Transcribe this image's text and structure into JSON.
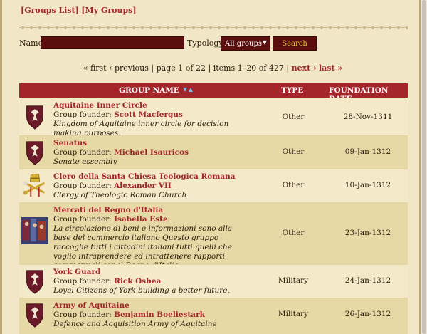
{
  "top_links": {
    "groups_list": "[Groups List]",
    "my_groups": "[My Groups]"
  },
  "search": {
    "name_label": "Name",
    "typology_label": "Typology",
    "typology_value": "All groups",
    "search_button": "Search"
  },
  "pager": {
    "first": "« first",
    "previous": "‹ previous",
    "sep1": "|",
    "page_info": "page 1 of 22",
    "sep2": "|",
    "items_info": "items 1–20 of 427",
    "sep3": "|",
    "next": "next ›",
    "last": "last »"
  },
  "table": {
    "headers": {
      "group_name": "GROUP NAME",
      "type": "TYPE",
      "foundation_date": "FOUNDATION DATE"
    },
    "rows": [
      {
        "name": "Aquitaine Inner Circle",
        "founder_prefix": "Group founder:",
        "founder": "Scott Macfergus",
        "description": "Kingdom of Aquitaine inner circle for decision making purposes.",
        "type": "Other",
        "date": "28-Nov-1311",
        "emblem": "phoenix-shield"
      },
      {
        "name": "Senatus",
        "founder_prefix": "Group founder:",
        "founder": "Michael Isauricos",
        "description": "Senate assembly",
        "type": "Other",
        "date": "09-Jan-1312",
        "emblem": "phoenix-shield"
      },
      {
        "name": "Clero della Santa Chiesa Teologica Romana",
        "founder_prefix": "Group founder:",
        "founder": "Alexander VII",
        "description": "Clergy of Theologic Roman Church",
        "type": "Other",
        "date": "10-Jan-1312",
        "emblem": "papal-keys"
      },
      {
        "name": "Mercati del Regno d'Italia",
        "founder_prefix": "Group founder:",
        "founder": "Isabella Este",
        "description": "La circolazione di beni e informazioni sono alla base del commercio italiano Questo gruppo raccoglie tutti i cittadini italiani tutti quelli che voglio intraprendere ed intrattenere rapporti commerciali con il Regno d'Italia.",
        "type": "Other",
        "date": "23-Jan-1312",
        "emblem": "market-painting"
      },
      {
        "name": "York Guard",
        "founder_prefix": "Group founder:",
        "founder": "Rick Oshea",
        "description": "Loyal Citizens of York building a better future.",
        "type": "Military",
        "date": "24-Jan-1312",
        "emblem": "phoenix-shield"
      },
      {
        "name": "Army of Aquitaine",
        "founder_prefix": "Group founder:",
        "founder": "Benjamin Boeliestark",
        "description": "Defence and Acquisition Army of Aquitaine",
        "type": "Military",
        "date": "26-Jan-1312",
        "emblem": "phoenix-shield"
      }
    ]
  },
  "colors": {
    "accent": "#a5262a",
    "dark_input": "#5a0e0e",
    "parchment": "#f1e6c6"
  }
}
